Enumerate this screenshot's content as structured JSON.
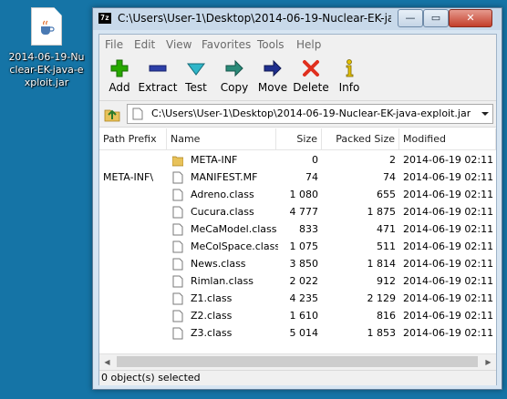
{
  "desktop": {
    "file_label": "2014-06-19-Nuclear-EK-java-exploit.jar"
  },
  "window": {
    "app_badge": "7z",
    "title": "C:\\Users\\User-1\\Desktop\\2014-06-19-Nuclear-EK-java-...",
    "controls": {
      "minimize": "—",
      "maximize": "▭",
      "close": "✕"
    }
  },
  "menu": [
    "File",
    "Edit",
    "View",
    "Favorites",
    "Tools",
    "Help"
  ],
  "toolbar": [
    {
      "label": "Add",
      "icon": "add-icon",
      "color": "#27a800"
    },
    {
      "label": "Extract",
      "icon": "extract-icon",
      "color": "#2d3fa8"
    },
    {
      "label": "Test",
      "icon": "test-icon",
      "color": "#2fb6c9"
    },
    {
      "label": "Copy",
      "icon": "copy-icon",
      "color": "#2a8a78"
    },
    {
      "label": "Move",
      "icon": "move-icon",
      "color": "#1f2f8f"
    },
    {
      "label": "Delete",
      "icon": "delete-icon",
      "color": "#e02f1e"
    },
    {
      "label": "Info",
      "icon": "info-icon",
      "color": "#e5c100"
    }
  ],
  "address": {
    "path": "C:\\Users\\User-1\\Desktop\\2014-06-19-Nuclear-EK-java-exploit.jar\\"
  },
  "columns": [
    "Path Prefix",
    "Name",
    "Size",
    "Packed Size",
    "Modified"
  ],
  "rows": [
    {
      "prefix": "",
      "name": "META-INF",
      "type": "folder",
      "size": "0",
      "packed": "2",
      "modified": "2014-06-19 02:11"
    },
    {
      "prefix": "META-INF\\",
      "name": "MANIFEST.MF",
      "type": "file",
      "size": "74",
      "packed": "74",
      "modified": "2014-06-19 02:11"
    },
    {
      "prefix": "",
      "name": "Adreno.class",
      "type": "file",
      "size": "1 080",
      "packed": "655",
      "modified": "2014-06-19 02:11"
    },
    {
      "prefix": "",
      "name": "Cucura.class",
      "type": "file",
      "size": "4 777",
      "packed": "1 875",
      "modified": "2014-06-19 02:11"
    },
    {
      "prefix": "",
      "name": "MeCaModel.class",
      "type": "file",
      "size": "833",
      "packed": "471",
      "modified": "2014-06-19 02:11"
    },
    {
      "prefix": "",
      "name": "MeColSpace.class",
      "type": "file",
      "size": "1 075",
      "packed": "511",
      "modified": "2014-06-19 02:11"
    },
    {
      "prefix": "",
      "name": "News.class",
      "type": "file",
      "size": "3 850",
      "packed": "1 814",
      "modified": "2014-06-19 02:11"
    },
    {
      "prefix": "",
      "name": "Rimlan.class",
      "type": "file",
      "size": "2 022",
      "packed": "912",
      "modified": "2014-06-19 02:11"
    },
    {
      "prefix": "",
      "name": "Z1.class",
      "type": "file",
      "size": "4 235",
      "packed": "2 129",
      "modified": "2014-06-19 02:11"
    },
    {
      "prefix": "",
      "name": "Z2.class",
      "type": "file",
      "size": "1 610",
      "packed": "816",
      "modified": "2014-06-19 02:11"
    },
    {
      "prefix": "",
      "name": "Z3.class",
      "type": "file",
      "size": "5 014",
      "packed": "1 853",
      "modified": "2014-06-19 02:11"
    }
  ],
  "status": {
    "text": "0 object(s) selected"
  },
  "colors": {
    "desktop": "#1574a6",
    "folder": "#e8c25a"
  }
}
